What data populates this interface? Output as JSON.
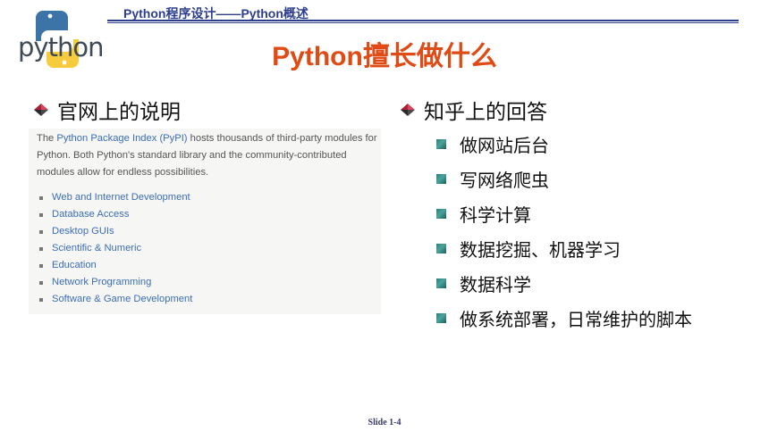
{
  "header": {
    "logo_text": "python",
    "breadcrumb": "Python程序设计——Python概述"
  },
  "title": "Python擅长做什么",
  "left": {
    "heading": "官网上的说明",
    "desc_pre": "The ",
    "desc_link": "Python Package Index (PyPI)",
    "desc_post": " hosts thousands of third-party modules for Python. Both Python's standard library and the community-contributed modules allow for endless possibilities.",
    "items": [
      "Web and Internet Development",
      "Database Access",
      "Desktop GUIs",
      "Scientific & Numeric",
      "Education",
      "Network Programming",
      "Software & Game Development"
    ]
  },
  "right": {
    "heading": "知乎上的回答",
    "items": [
      "做网站后台",
      "写网络爬虫",
      "科学计算",
      "数据挖掘、机器学习",
      "数据科学",
      "做系统部署，日常维护的脚本"
    ]
  },
  "footer": "Slide 1-4",
  "colors": {
    "title": "#e04a14",
    "header": "#2d3f8c",
    "link": "#3c6eb4",
    "bullet": "#2f7f7a"
  }
}
